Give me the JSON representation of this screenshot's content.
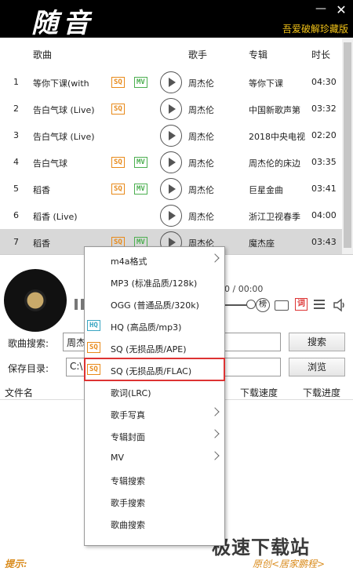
{
  "app": {
    "logo": "随音",
    "edition": "吾爱破解珍藏版",
    "minimize_glyph": "—",
    "close_glyph": "✕"
  },
  "list_header": {
    "song": "歌曲",
    "artist": "歌手",
    "album": "专辑",
    "duration": "时长"
  },
  "songs": [
    {
      "num": "1",
      "title": "等你下课(with",
      "sq": true,
      "mv": true,
      "artist": "周杰伦",
      "album": "等你下课",
      "time": "04:30"
    },
    {
      "num": "2",
      "title": "告白气球 (Live)",
      "sq": true,
      "mv": false,
      "artist": "周杰伦",
      "album": "中国新歌声第",
      "time": "03:32"
    },
    {
      "num": "3",
      "title": "告白气球 (Live)",
      "sq": false,
      "mv": false,
      "artist": "周杰伦",
      "album": "2018中央电视",
      "time": "02:20"
    },
    {
      "num": "4",
      "title": "告白气球",
      "sq": true,
      "mv": true,
      "artist": "周杰伦",
      "album": "周杰伦的床边",
      "time": "03:35"
    },
    {
      "num": "5",
      "title": "稻香",
      "sq": true,
      "mv": true,
      "artist": "周杰伦",
      "album": "巨星金曲",
      "time": "03:41"
    },
    {
      "num": "6",
      "title": "稻香 (Live)",
      "sq": false,
      "mv": false,
      "artist": "周杰伦",
      "album": "浙江卫视春季",
      "time": "04:00"
    },
    {
      "num": "7",
      "title": "稻香",
      "sq": true,
      "mv": true,
      "artist": "周杰伦",
      "album": "魔杰座",
      "time": "03:43",
      "selected": true
    }
  ],
  "badges": {
    "sq": "SQ",
    "mv": "MV",
    "hq": "HQ"
  },
  "player": {
    "time_display": "0 / 00:00",
    "bang_label": "榜",
    "lyric_label": "词"
  },
  "search": {
    "song_label": "歌曲搜索:",
    "song_value": "周杰",
    "search_button": "搜索",
    "dir_label": "保存目录:",
    "dir_value": "C:\\",
    "browse_button": "浏览"
  },
  "download_header": {
    "filename": "文件名",
    "speed": "下载速度",
    "progress": "下载进度"
  },
  "context_menu": [
    {
      "label": "m4a格式",
      "badge": "",
      "arrow": true
    },
    {
      "label": "MP3 (标准品质/128k)",
      "badge": "",
      "arrow": false
    },
    {
      "label": "OGG (普通品质/320k)",
      "badge": "",
      "arrow": false
    },
    {
      "label": "HQ (高品质/mp3)",
      "badge": "hq",
      "arrow": false
    },
    {
      "label": "SQ (无损品质/APE)",
      "badge": "sq",
      "arrow": false
    },
    {
      "label": "SQ (无损品质/FLAC)",
      "badge": "sq",
      "arrow": false,
      "highlight": true
    },
    {
      "label": "歌词(LRC)",
      "badge": "",
      "arrow": false
    },
    {
      "label": "歌手写真",
      "badge": "",
      "arrow": true
    },
    {
      "label": "专辑封面",
      "badge": "",
      "arrow": true
    },
    {
      "label": "MV",
      "badge": "",
      "arrow": true
    },
    {
      "label": "专辑搜索",
      "badge": "",
      "arrow": false
    },
    {
      "label": "歌手搜索",
      "badge": "",
      "arrow": false
    },
    {
      "label": "歌曲搜索",
      "badge": "",
      "arrow": false
    }
  ],
  "footer": {
    "tip": "提示:",
    "credit": "原创<居家鹏程>",
    "watermark": "极速下载站"
  }
}
